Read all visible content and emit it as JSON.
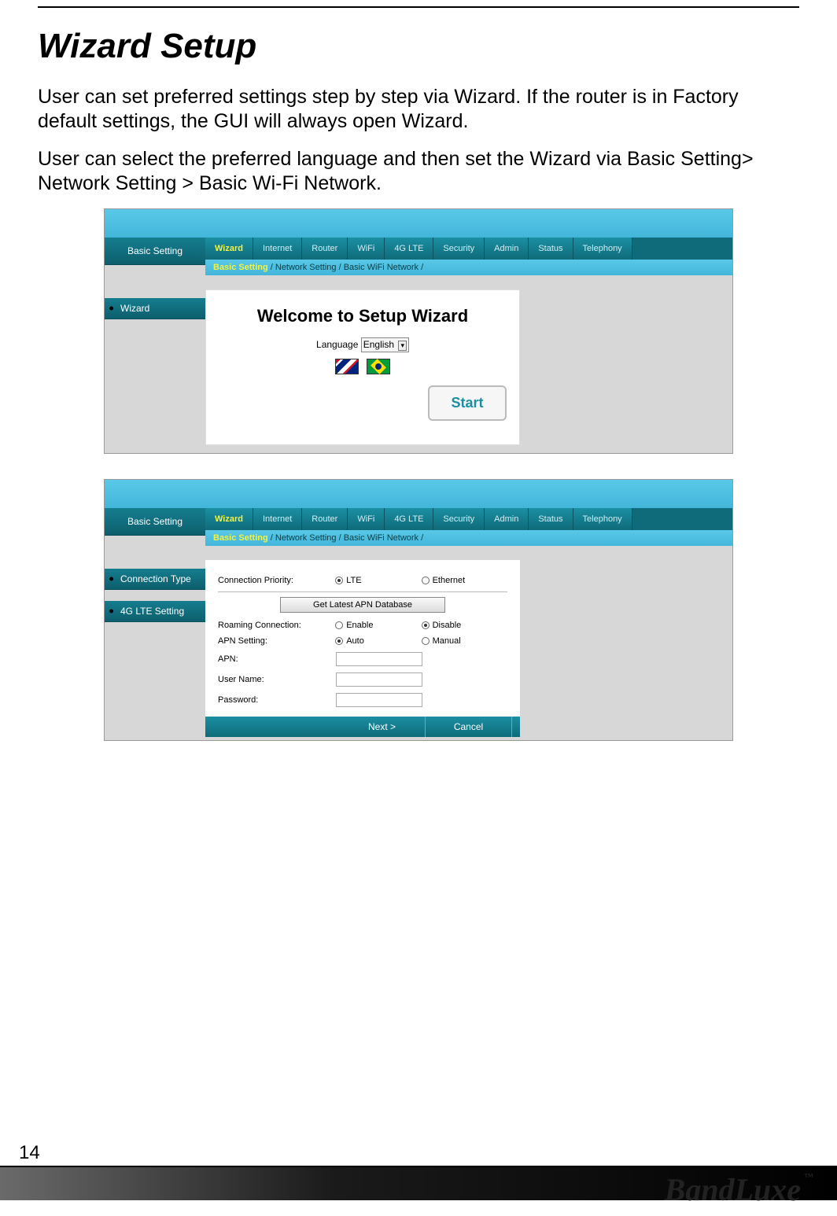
{
  "page_number": "14",
  "title": "Wizard Setup",
  "paragraphs": {
    "p1": "User can set preferred settings step by step via Wizard. If the router is in Factory default settings, the GUI will always open Wizard.",
    "p2": "User can select the preferred language and then set the Wizard via Basic Setting> Network Setting > Basic Wi-Fi Network."
  },
  "brand": "BandLuxe",
  "brand_tm": "™",
  "screenshot1": {
    "sidebar_head": "Basic Setting",
    "sidebar_items": [
      "Wizard"
    ],
    "tabs": [
      "Wizard",
      "Internet",
      "Router",
      "WiFi",
      "4G LTE",
      "Security",
      "Admin",
      "Status",
      "Telephony"
    ],
    "active_tab": "Wizard",
    "crumbs": {
      "c1": "Basic Setting",
      "sep": " /  ",
      "c2": "Network Setting",
      "c3": "Basic WiFi Network"
    },
    "welcome": "Welcome to Setup Wizard",
    "language_label": "Language",
    "language_value": "English",
    "start": "Start"
  },
  "screenshot2": {
    "sidebar_head": "Basic Setting",
    "sidebar_items": [
      "Connection Type",
      "4G LTE Setting"
    ],
    "tabs": [
      "Wizard",
      "Internet",
      "Router",
      "WiFi",
      "4G LTE",
      "Security",
      "Admin",
      "Status",
      "Telephony"
    ],
    "active_tab": "Wizard",
    "crumbs": {
      "c1": "Basic Setting",
      "sep": " /  ",
      "c2": "Network Setting",
      "c3": "Basic WiFi Network"
    },
    "fields": {
      "conn_priority": "Connection Priority:",
      "conn_lte": "LTE",
      "conn_eth": "Ethernet",
      "apn_db_btn": "Get Latest APN Database",
      "roaming": "Roaming Connection:",
      "roaming_enable": "Enable",
      "roaming_disable": "Disable",
      "apn_setting": "APN Setting:",
      "apn_auto": "Auto",
      "apn_manual": "Manual",
      "apn": "APN:",
      "user": "User Name:",
      "pass": "Password:"
    },
    "buttons": {
      "next": "Next >",
      "cancel": "Cancel"
    }
  }
}
